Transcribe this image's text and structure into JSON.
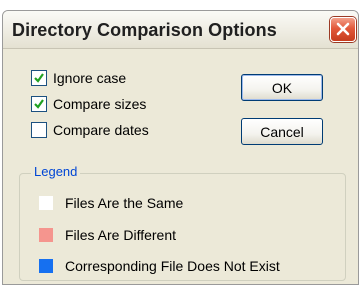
{
  "dialog": {
    "title": "Directory Comparison Options"
  },
  "options": [
    {
      "label": "Ignore case",
      "checked": true
    },
    {
      "label": "Compare sizes",
      "checked": true
    },
    {
      "label": "Compare dates",
      "checked": false
    }
  ],
  "buttons": {
    "ok_label": "OK",
    "cancel_label": "Cancel"
  },
  "legend": {
    "title": "Legend",
    "items": [
      {
        "label": "Files Are the Same",
        "color": "#ffffff"
      },
      {
        "label": "Files Are Different",
        "color": "#f5958e"
      },
      {
        "label": "Corresponding File Does Not Exist",
        "color": "#1670f0"
      }
    ]
  },
  "colors": {
    "window_bg": "#ece9d8",
    "checkmark": "#21a121",
    "close_button": "#e2593b",
    "legend_title": "#0046d5"
  }
}
